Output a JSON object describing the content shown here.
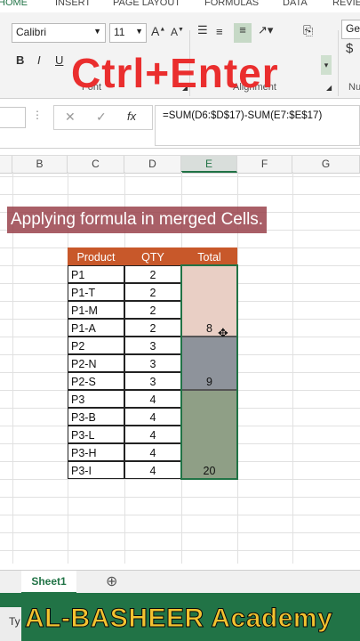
{
  "ribbon_tabs": [
    "HOME",
    "INSERT",
    "PAGE LAYOUT",
    "FORMULAS",
    "DATA",
    "REVIE"
  ],
  "font": {
    "name": "Calibri",
    "size": "11",
    "bold": "B",
    "italic": "I",
    "underline": "U",
    "group_label": "Font"
  },
  "alignment": {
    "group_label": "Alignment"
  },
  "number": {
    "format_value": "Ger",
    "currency_symbol": "$",
    "group_label": "Nu"
  },
  "overlay_title": "Ctrl+Enter",
  "formula_bar": {
    "cancel": "✕",
    "enter": "✓",
    "fx": "fx",
    "formula": "=SUM(D6:$D$17)-SUM(E7:$E$17)"
  },
  "columns": [
    "B",
    "C",
    "D",
    "E",
    "F",
    "G"
  ],
  "selected_column": "E",
  "caption": "Applying formula in merged Cells.",
  "table": {
    "headers": [
      "Product",
      "QTY",
      "Total"
    ],
    "rows": [
      {
        "product": "P1",
        "qty": "2"
      },
      {
        "product": "P1-T",
        "qty": "2"
      },
      {
        "product": "P1-M",
        "qty": "2"
      },
      {
        "product": "P1-A",
        "qty": "2"
      },
      {
        "product": "P2",
        "qty": "3"
      },
      {
        "product": "P2-N",
        "qty": "3"
      },
      {
        "product": "P2-S",
        "qty": "3"
      },
      {
        "product": "P3",
        "qty": "4"
      },
      {
        "product": "P3-B",
        "qty": "4"
      },
      {
        "product": "P3-L",
        "qty": "4"
      },
      {
        "product": "P3-H",
        "qty": "4"
      },
      {
        "product": "P3-I",
        "qty": "4"
      }
    ],
    "merged_totals": [
      {
        "value": "8",
        "color": "#e9cfc5"
      },
      {
        "value": "9",
        "color": "#8e939b"
      },
      {
        "value": "20",
        "color": "#8f9f86"
      }
    ]
  },
  "sheet_tab": "Sheet1",
  "add_sheet": "⊕",
  "status_text": "Ty",
  "brand": "AL-BASHEER Academy",
  "colors": {
    "excel_green": "#217346",
    "header_orange": "#c8582a",
    "overlay_red": "#ea2e2e",
    "brand_yellow": "#f2c230"
  }
}
